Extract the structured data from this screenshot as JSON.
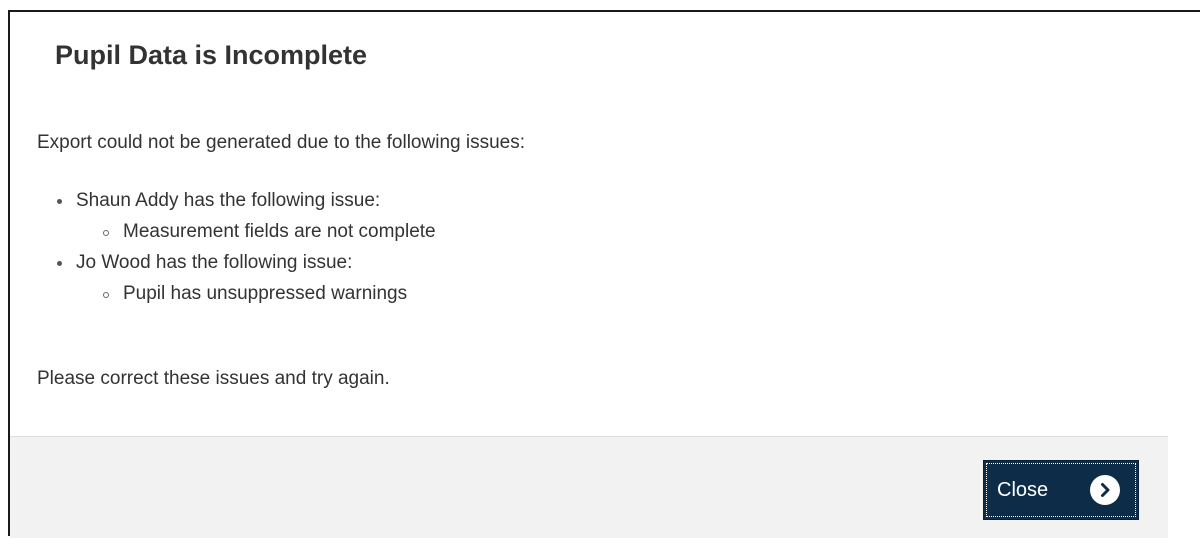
{
  "dialog": {
    "title": "Pupil Data is Incomplete",
    "intro": "Export could not be generated due to the following issues:",
    "issues": [
      {
        "text": "Shaun Addy has the following issue:",
        "details": [
          "Measurement fields are not complete"
        ]
      },
      {
        "text": "Jo Wood has the following issue:",
        "details": [
          "Pupil has unsuppressed warnings"
        ]
      }
    ],
    "outro": "Please correct these issues and try again.",
    "close_label": "Close",
    "close_icon": "chevron-right-circle-icon"
  },
  "colors": {
    "button_background": "#0c2c48",
    "footer_background": "#f2f2f2",
    "text": "#333333"
  }
}
